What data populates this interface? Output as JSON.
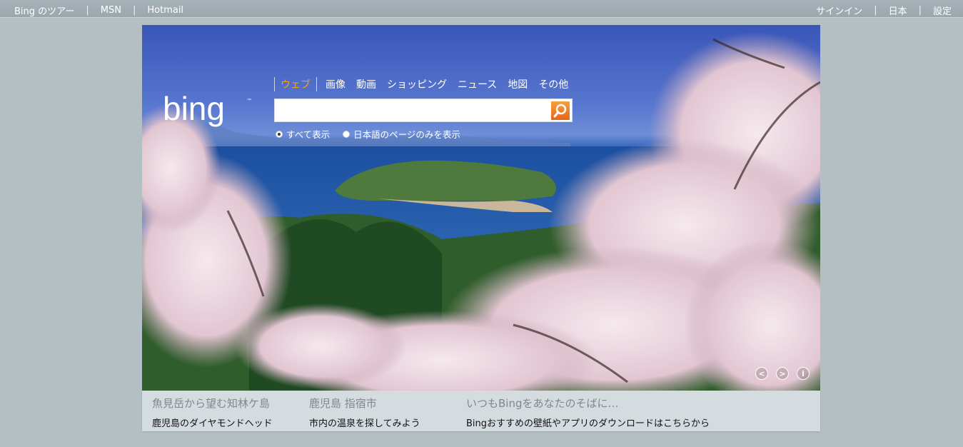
{
  "topbar": {
    "left_links": [
      "Bing のツアー",
      "MSN",
      "Hotmail"
    ],
    "right_links": [
      "サインイン",
      "日本",
      "設定"
    ]
  },
  "logo": {
    "text": "bing"
  },
  "search": {
    "tabs": [
      "ウェブ",
      "画像",
      "動画",
      "ショッピング",
      "ニュース",
      "地図",
      "その他"
    ],
    "active_tab": "ウェブ",
    "input_value": "",
    "radio_all": "すべて表示",
    "radio_japanese": "日本語のページのみを表示",
    "selected_radio": "すべて表示"
  },
  "hero_controls": {
    "prev": "<",
    "next": ">",
    "info": "i"
  },
  "captions": [
    {
      "title": "魚見岳から望む知林ケ島",
      "subtitle": "鹿児島のダイヤモンドヘッド"
    },
    {
      "title": "鹿児島 指宿市",
      "subtitle": "市内の温泉を探してみよう"
    },
    {
      "title": "いつもBingをあなたのそばに…",
      "subtitle": "Bingおすすめの壁紙やアプリのダウンロードはこちらから"
    }
  ],
  "colors": {
    "accent": "#f3a21c",
    "search_button": "#e7651a",
    "page_bg": "#b4bfc4",
    "caption_bg": "#d5dcdf"
  }
}
